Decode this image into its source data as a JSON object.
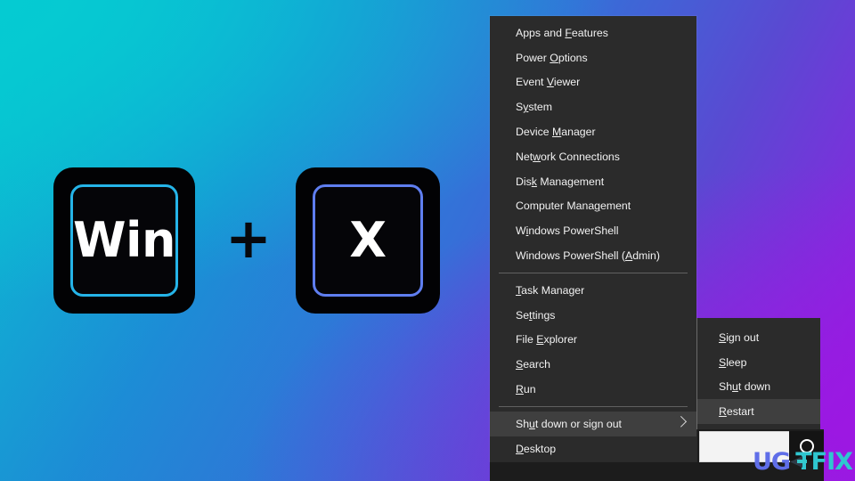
{
  "wallpaper": {
    "gradient_start": "#05cbd2",
    "gradient_mid": "#3570d8",
    "gradient_end": "#9d17e2"
  },
  "shortcut": {
    "key1_label": "Win",
    "plus_label": "+",
    "key2_label": "X",
    "key1_border_color": "#25b4e8",
    "key2_border_color": "#5f7ef0"
  },
  "win_x_menu": {
    "background": "#2b2b2b",
    "highlight_color": "#3f3f3f",
    "groups": [
      {
        "items": [
          {
            "pre": "Apps and ",
            "acc": "F",
            "post": "eatures"
          },
          {
            "pre": "Power ",
            "acc": "O",
            "post": "ptions"
          },
          {
            "pre": "Event ",
            "acc": "V",
            "post": "iewer"
          },
          {
            "pre": "S",
            "acc": "y",
            "post": "stem"
          },
          {
            "pre": "Device ",
            "acc": "M",
            "post": "anager"
          },
          {
            "pre": "Net",
            "acc": "w",
            "post": "ork Connections"
          },
          {
            "pre": "Dis",
            "acc": "k",
            "post": " Management"
          },
          {
            "pre": "Computer Mana",
            "acc": "g",
            "post": "ement"
          },
          {
            "pre": "W",
            "acc": "i",
            "post": "ndows PowerShell"
          },
          {
            "pre": "Windows PowerShell (",
            "acc": "A",
            "post": "dmin)"
          }
        ]
      },
      {
        "items": [
          {
            "pre": "",
            "acc": "T",
            "post": "ask Manager"
          },
          {
            "pre": "Se",
            "acc": "t",
            "post": "tings"
          },
          {
            "pre": "File ",
            "acc": "E",
            "post": "xplorer"
          },
          {
            "pre": "",
            "acc": "S",
            "post": "earch"
          },
          {
            "pre": "",
            "acc": "R",
            "post": "un"
          }
        ]
      },
      {
        "items": [
          {
            "pre": "Sh",
            "acc": "u",
            "post": "t down or sign out",
            "highlighted": true,
            "has_submenu": true
          },
          {
            "pre": "",
            "acc": "D",
            "post": "esktop"
          }
        ]
      }
    ]
  },
  "shutdown_submenu": {
    "items": [
      {
        "pre": "",
        "acc": "S",
        "post": "ign out"
      },
      {
        "pre": "",
        "acc": "S",
        "post": "leep"
      },
      {
        "pre": "Sh",
        "acc": "u",
        "post": "t down"
      },
      {
        "pre": "",
        "acc": "R",
        "post": "estart",
        "highlighted": true
      }
    ]
  },
  "taskbar": {
    "search_placeholder": "",
    "cortana_icon": "cortana-ring-icon"
  },
  "watermark": {
    "part1": "UG",
    "arrow": "arrow-left-icon",
    "part2": "TFIX",
    "color1": "#5f6ee8",
    "color2": "#2fc6cf"
  }
}
